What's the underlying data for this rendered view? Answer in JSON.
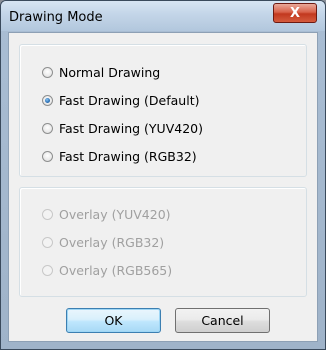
{
  "window": {
    "title": "Drawing Mode",
    "close_label": "X"
  },
  "drawing_group": {
    "options": [
      {
        "label": "Normal Drawing",
        "selected": false
      },
      {
        "label": "Fast Drawing (Default)",
        "selected": true
      },
      {
        "label": "Fast Drawing (YUV420)",
        "selected": false
      },
      {
        "label": "Fast Drawing (RGB32)",
        "selected": false
      }
    ]
  },
  "overlay_group": {
    "enabled": false,
    "options": [
      {
        "label": "Overlay (YUV420)",
        "selected": false
      },
      {
        "label": "Overlay (RGB32)",
        "selected": false
      },
      {
        "label": "Overlay (RGB565)",
        "selected": false
      }
    ]
  },
  "buttons": {
    "ok_label": "OK",
    "cancel_label": "Cancel"
  },
  "colors": {
    "accent": "#3c7fb1",
    "close_button": "#c2381f",
    "disabled_text": "#a0a0a0"
  }
}
